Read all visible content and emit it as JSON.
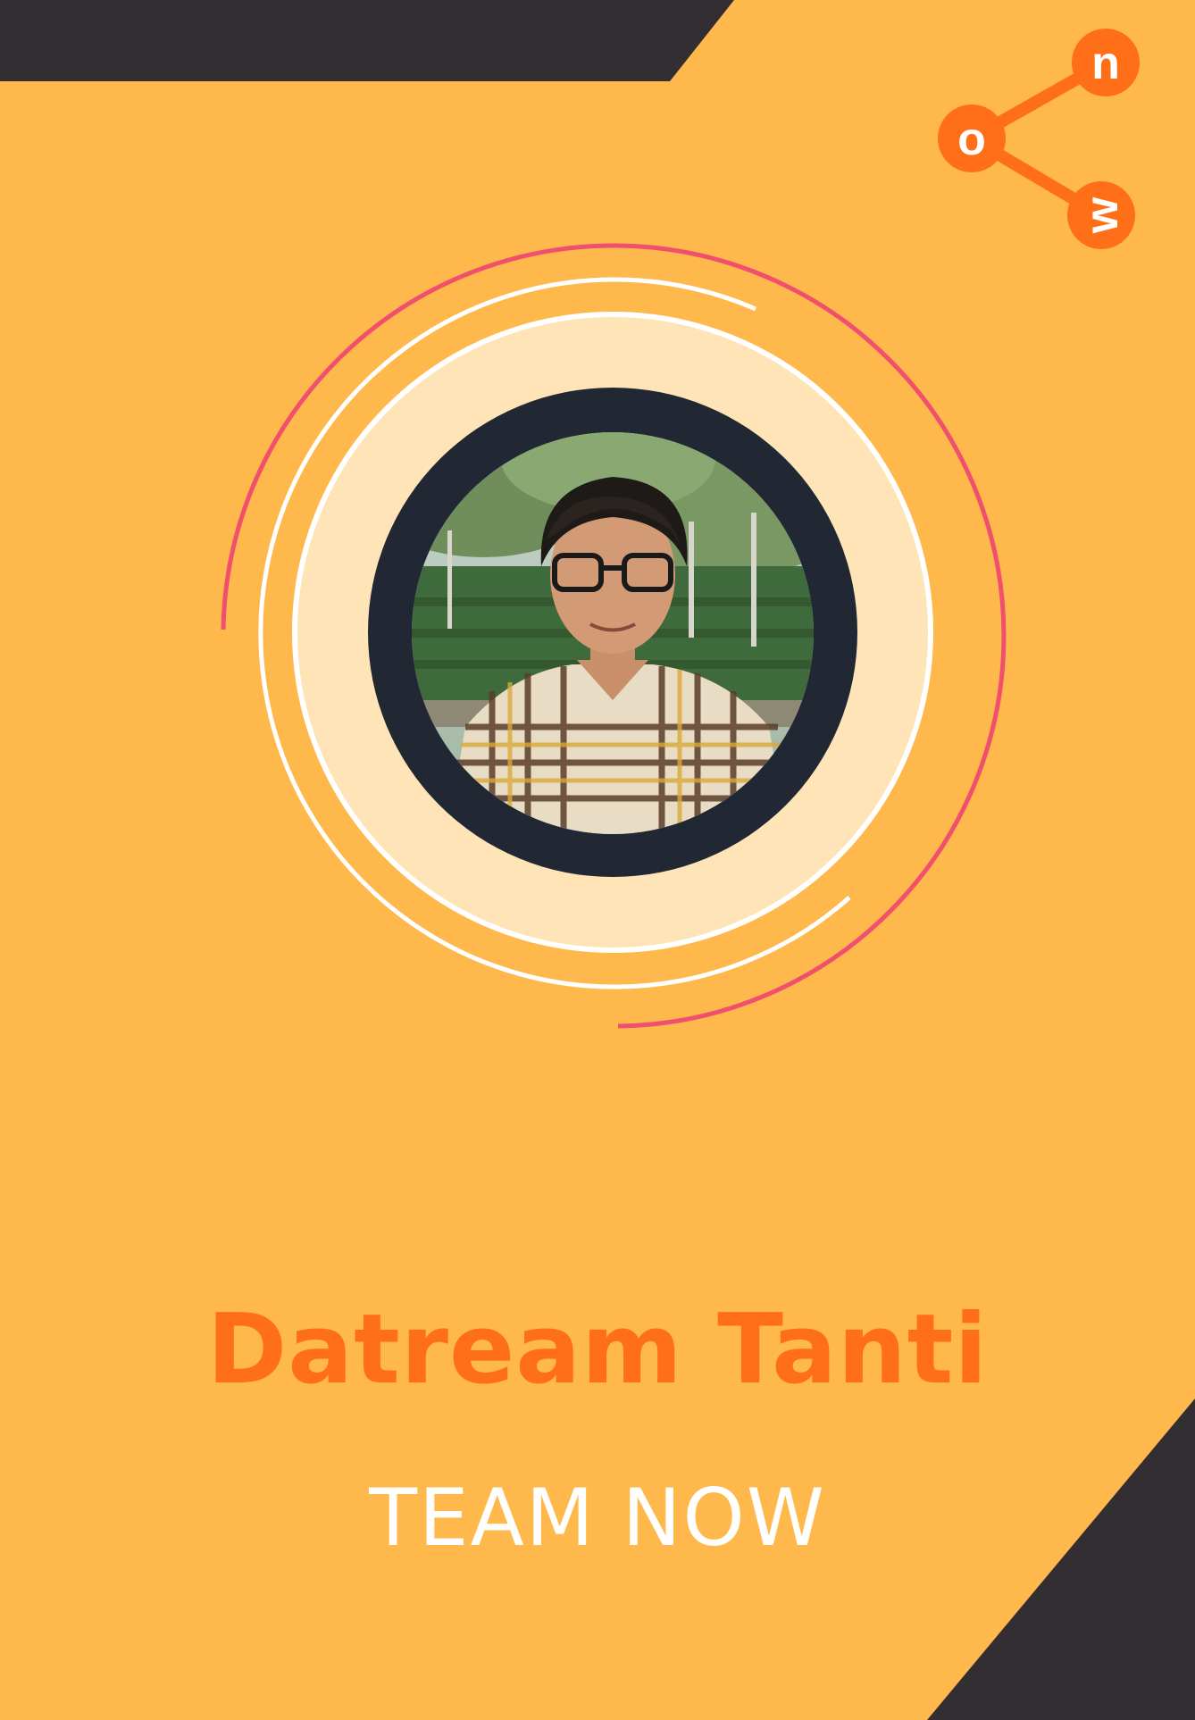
{
  "profile": {
    "name": "Datream Tanti",
    "team": "TEAM NOW"
  },
  "logo": {
    "letters": [
      "n",
      "o",
      "w"
    ]
  },
  "colors": {
    "background": "#ffb84b",
    "dark": "#322e31",
    "accent": "#ff6f17",
    "pink_ring": "#f0506e",
    "inner_disc": "#ffe4b8",
    "photo_frame": "#212833"
  }
}
